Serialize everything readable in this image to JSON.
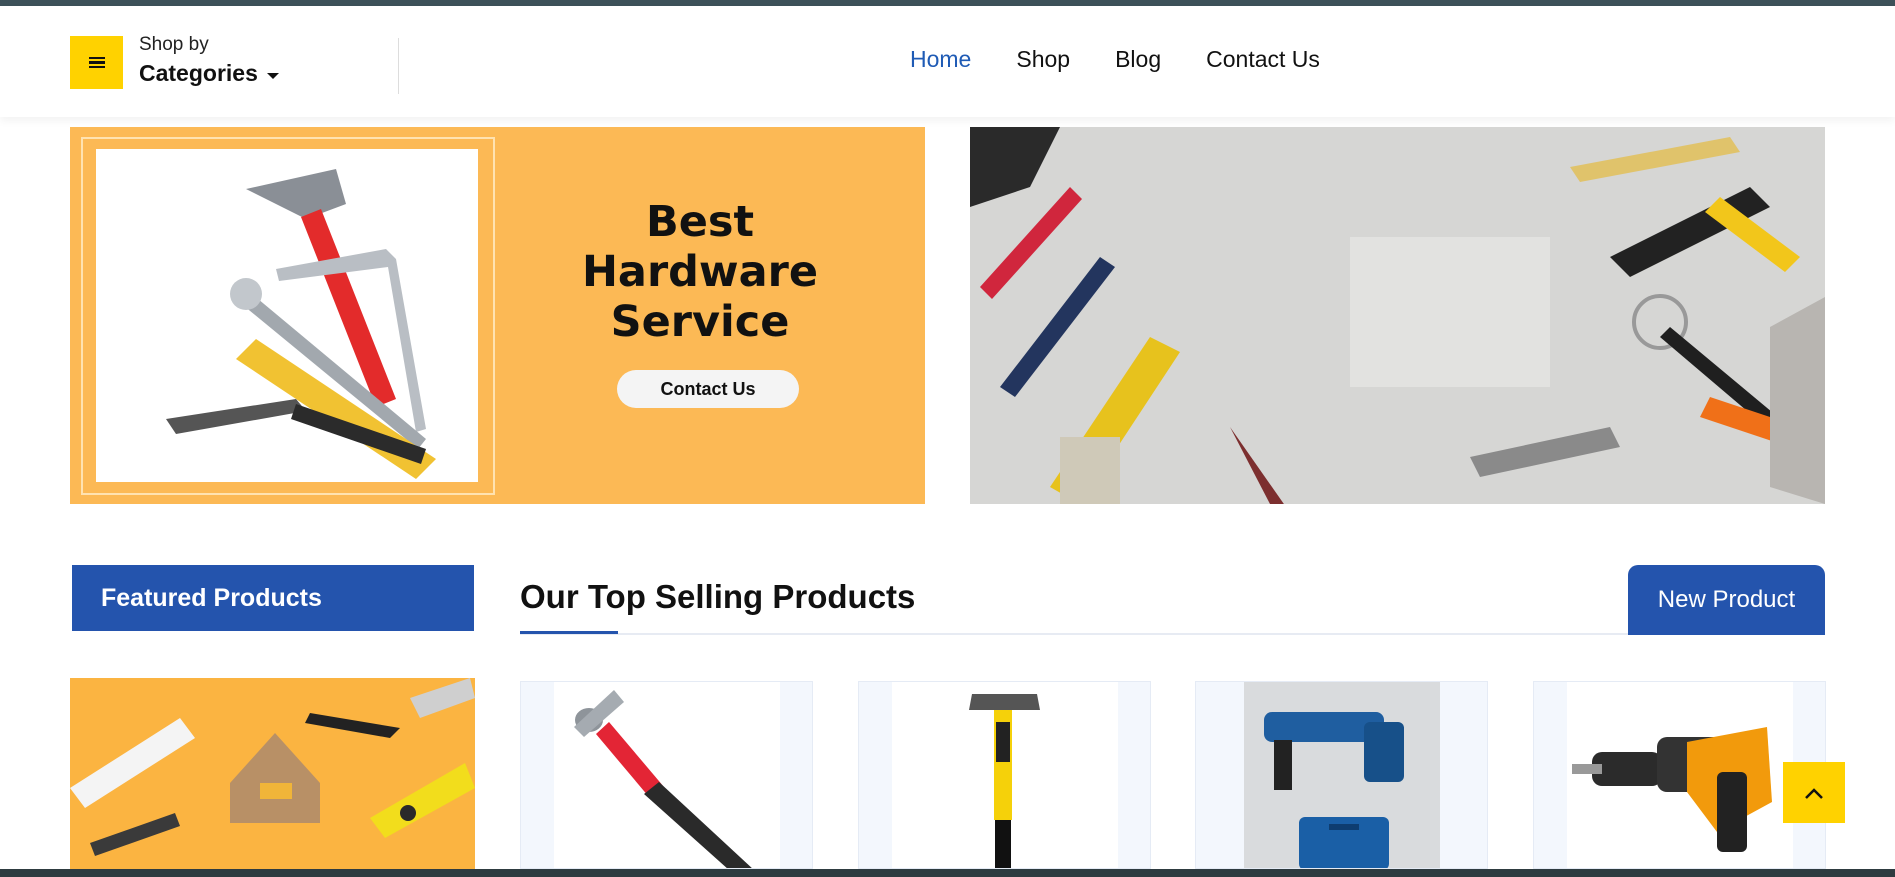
{
  "header": {
    "category_small": "Shop by",
    "category_big": "Categories",
    "nav": [
      {
        "label": "Home",
        "active": true
      },
      {
        "label": "Shop"
      },
      {
        "label": "Blog"
      },
      {
        "label": "Contact Us"
      }
    ]
  },
  "banners": {
    "left": {
      "headline_line1": "Best",
      "headline_line2": "Hardware",
      "headline_line3": "Service",
      "cta": "Contact Us"
    }
  },
  "sections": {
    "featured_title": "Featured Products",
    "top_selling_title": "Our Top Selling Products",
    "new_product_tab": "New Product"
  },
  "colors": {
    "accent_blue": "#2454ad",
    "accent_yellow": "#ffd200",
    "banner_orange": "#fcb955",
    "nav_active": "#1f5bb5"
  },
  "icons": {
    "menu": "hamburger-icon",
    "dropdown": "caret-down-icon",
    "scroll_top": "chevron-up-icon"
  }
}
